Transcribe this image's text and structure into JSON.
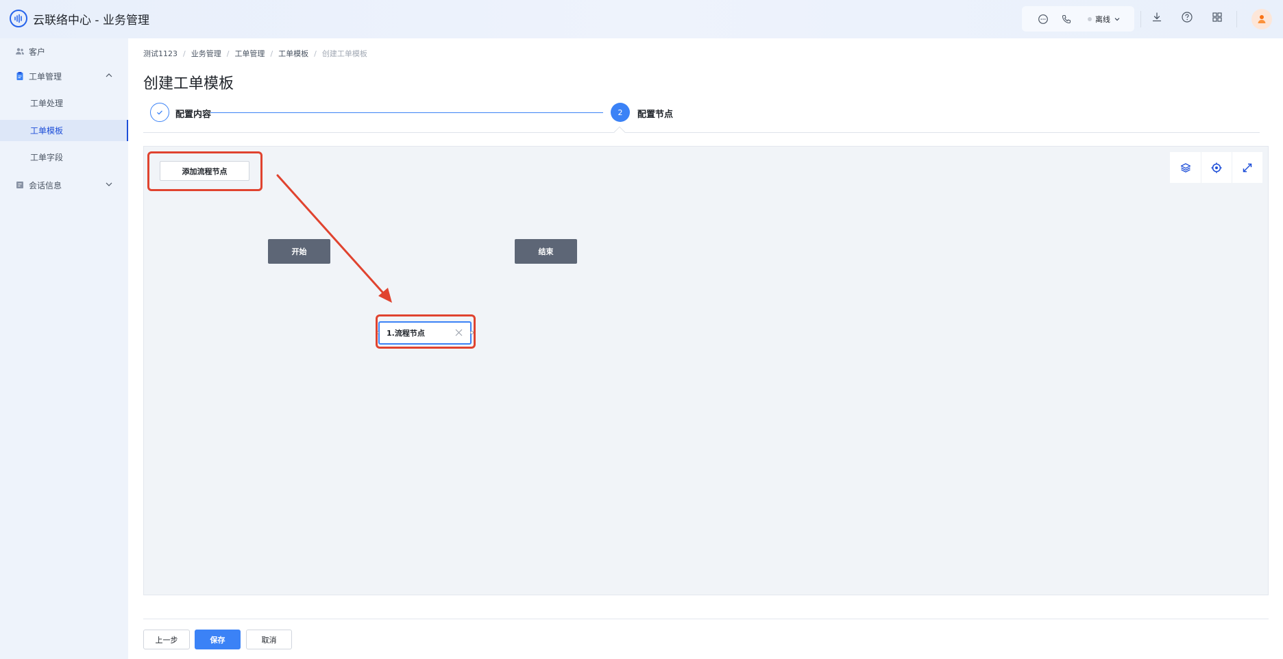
{
  "app": {
    "title": "云联络中心 - 业务管理",
    "status_label": "离线"
  },
  "sidebar": {
    "items": [
      {
        "label": "客户",
        "icon": "users-icon"
      },
      {
        "label": "工单管理",
        "icon": "clipboard-icon"
      },
      {
        "label": "会话信息",
        "icon": "chat-record-icon"
      }
    ],
    "sub_items": [
      {
        "label": "工单处理"
      },
      {
        "label": "工单模板"
      },
      {
        "label": "工单字段"
      }
    ]
  },
  "breadcrumb": [
    "测试1123",
    "业务管理",
    "工单管理",
    "工单模板",
    "创建工单模板"
  ],
  "page": {
    "title": "创建工单模板"
  },
  "steps": [
    {
      "number": "",
      "label": "配置内容",
      "state": "done"
    },
    {
      "number": "2",
      "label": "配置节点",
      "state": "active"
    }
  ],
  "canvas": {
    "add_node_label": "添加流程节点",
    "start_label": "开始",
    "end_label": "结束",
    "process_node_label": "1.流程节点"
  },
  "footer": {
    "prev_label": "上一步",
    "save_label": "保存",
    "cancel_label": "取消"
  },
  "colors": {
    "accent": "#3b82f6",
    "highlight": "#e0432f",
    "node_dark": "#5d6676"
  }
}
